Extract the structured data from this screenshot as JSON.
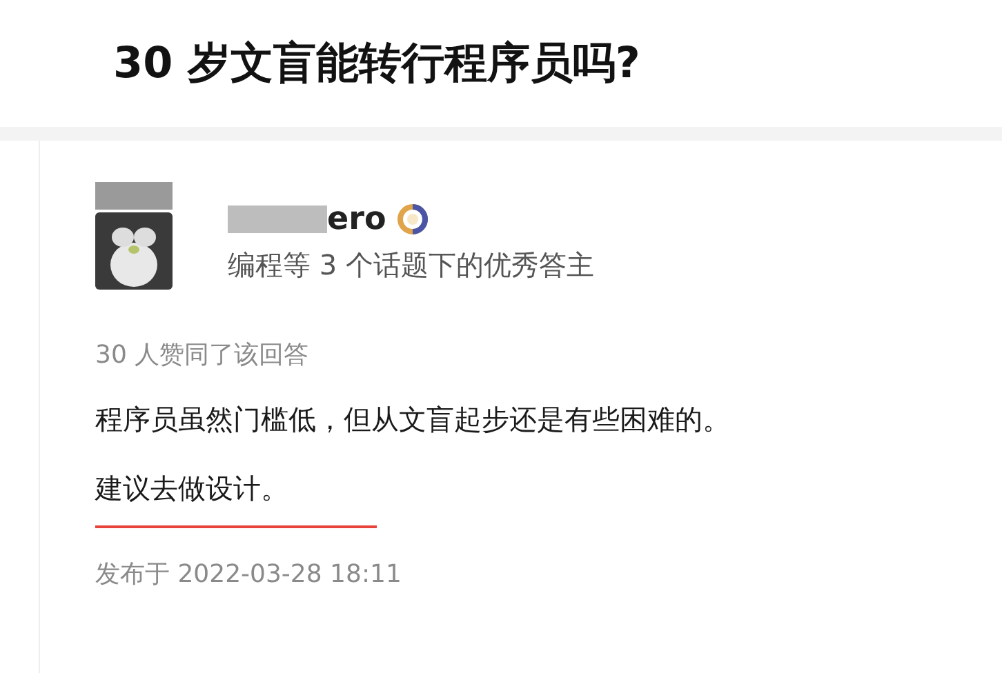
{
  "question": {
    "title": "30 岁文盲能转行程序员吗?"
  },
  "answer": {
    "author": {
      "name_visible": "ero",
      "credential": "编程等 3 个话题下的优秀答主"
    },
    "votes": "30 人赞同了该回答",
    "paragraphs": [
      {
        "text": "程序员虽然门槛低，但从文盲起步还是有些困难的。",
        "underlined": false
      },
      {
        "text": "建议去做设计。",
        "underlined": true
      }
    ],
    "published": "发布于 2022-03-28 18:11"
  }
}
